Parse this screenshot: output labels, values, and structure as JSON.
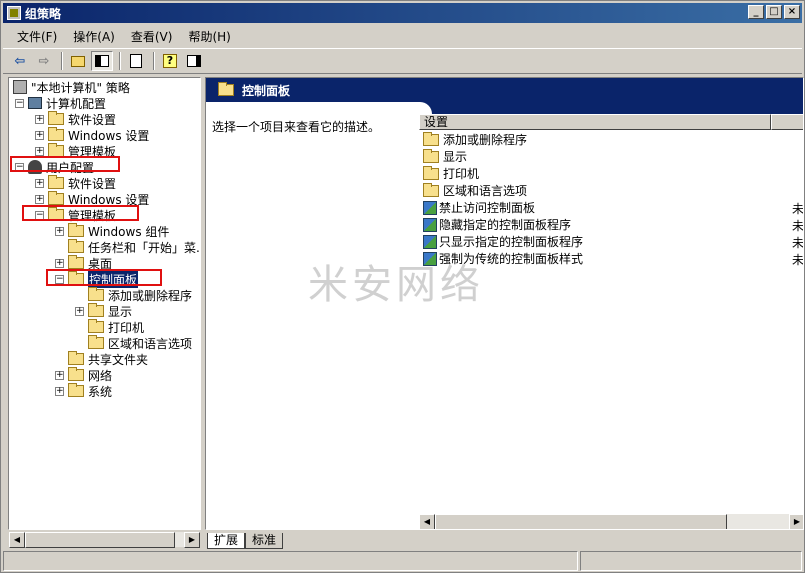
{
  "window": {
    "title": "组策略"
  },
  "menu": [
    {
      "label": "文件(F)"
    },
    {
      "label": "操作(A)"
    },
    {
      "label": "查看(V)"
    },
    {
      "label": "帮助(H)"
    }
  ],
  "tree": {
    "root": "\"本地计算机\" 策略",
    "computer_config": "计算机配置",
    "cc_software": "软件设置",
    "cc_windows": "Windows 设置",
    "cc_admin": "管理模板",
    "user_config": "用户配置",
    "uc_software": "软件设置",
    "uc_windows": "Windows 设置",
    "uc_admin": "管理模板",
    "windows_components": "Windows 组件",
    "taskbar_start": "任务栏和「开始」菜...",
    "desktop": "桌面",
    "control_panel": "控制面板",
    "add_remove": "添加或删除程序",
    "display": "显示",
    "printers": "打印机",
    "regional": "区域和语言选项",
    "shared_folders": "共享文件夹",
    "network": "网络",
    "system": "系统"
  },
  "right_pane": {
    "header": "控制面板",
    "description_prompt": "选择一个项目来查看它的描述。",
    "column_setting": "设置",
    "items": [
      {
        "type": "folder",
        "label": "添加或删除程序"
      },
      {
        "type": "folder",
        "label": "显示"
      },
      {
        "type": "folder",
        "label": "打印机"
      },
      {
        "type": "folder",
        "label": "区域和语言选项"
      },
      {
        "type": "setting",
        "label": "禁止访问控制面板",
        "state": "未"
      },
      {
        "type": "setting",
        "label": "隐藏指定的控制面板程序",
        "state": "未"
      },
      {
        "type": "setting",
        "label": "只显示指定的控制面板程序",
        "state": "未"
      },
      {
        "type": "setting",
        "label": "强制为传统的控制面板样式",
        "state": "未"
      }
    ]
  },
  "tabs": [
    {
      "label": "扩展"
    },
    {
      "label": "标准"
    }
  ],
  "watermark": "米安网络",
  "icons": {
    "back": "arrow-left-icon",
    "forward": "arrow-right-icon",
    "up": "folder-up-icon",
    "show_hide": "show-hide-tree-icon",
    "export": "export-list-icon",
    "help": "help-icon",
    "properties": "properties-icon"
  },
  "colors": {
    "title_bar": "#0a246a",
    "highlight": "#0a246a",
    "annotation_box": "#e01010",
    "window_bg": "#d4d0c8"
  }
}
